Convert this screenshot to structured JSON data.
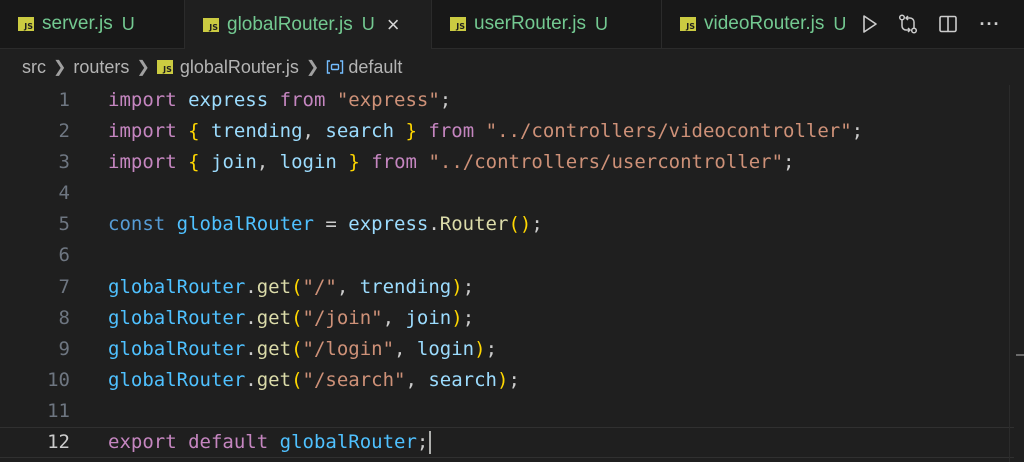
{
  "tabs": [
    {
      "name": "server.js",
      "status": "U",
      "active": false
    },
    {
      "name": "globalRouter.js",
      "status": "U",
      "active": true
    },
    {
      "name": "userRouter.js",
      "status": "U",
      "active": false
    },
    {
      "name": "videoRouter.js",
      "status": "U",
      "active": false
    }
  ],
  "tab_file_icon": "JS",
  "tab_close_glyph": "×",
  "editor_actions": [
    "run-icon",
    "compare-changes-icon",
    "split-editor-icon",
    "more-actions-icon"
  ],
  "more_glyph": "···",
  "breadcrumb": {
    "folder1": "src",
    "folder2": "routers",
    "file": "globalRouter.js",
    "symbol": "default"
  },
  "line_numbers": [
    "1",
    "2",
    "3",
    "4",
    "5",
    "6",
    "7",
    "8",
    "9",
    "10",
    "11",
    "12"
  ],
  "active_line": "12",
  "code": {
    "l1": {
      "t1": "import",
      "t2": " ",
      "t3": "express",
      "t4": " ",
      "t5": "from",
      "t6": " ",
      "t7": "\"express\"",
      "t8": ";"
    },
    "l2": {
      "t1": "import",
      "t2": " ",
      "t3": "{",
      "t4": " ",
      "t5": "trending",
      "t6": ", ",
      "t7": "search",
      "t8": " ",
      "t9": "}",
      "t10": " ",
      "t11": "from",
      "t12": " ",
      "t13": "\"../controllers/videocontroller\"",
      "t14": ";"
    },
    "l3": {
      "t1": "import",
      "t2": " ",
      "t3": "{",
      "t4": " ",
      "t5": "join",
      "t6": ", ",
      "t7": "login",
      "t8": " ",
      "t9": "}",
      "t10": " ",
      "t11": "from",
      "t12": " ",
      "t13": "\"../controllers/usercontroller\"",
      "t14": ";"
    },
    "l5": {
      "t1": "const",
      "t2": " ",
      "t3": "globalRouter",
      "t4": " = ",
      "t5": "express",
      "t6": ".",
      "t7": "Router",
      "t8": "(",
      "t9": ")",
      "t10": ";"
    },
    "l7": {
      "t1": "globalRouter",
      "t2": ".",
      "t3": "get",
      "t4": "(",
      "t5": "\"/\"",
      "t6": ", ",
      "t7": "trending",
      "t8": ")",
      "t9": ";"
    },
    "l8": {
      "t1": "globalRouter",
      "t2": ".",
      "t3": "get",
      "t4": "(",
      "t5": "\"/join\"",
      "t6": ", ",
      "t7": "join",
      "t8": ")",
      "t9": ";"
    },
    "l9": {
      "t1": "globalRouter",
      "t2": ".",
      "t3": "get",
      "t4": "(",
      "t5": "\"/login\"",
      "t6": ", ",
      "t7": "login",
      "t8": ")",
      "t9": ";"
    },
    "l10": {
      "t1": "globalRouter",
      "t2": ".",
      "t3": "get",
      "t4": "(",
      "t5": "\"/search\"",
      "t6": ", ",
      "t7": "search",
      "t8": ")",
      "t9": ";"
    },
    "l12": {
      "t1": "export",
      "t2": " ",
      "t3": "default",
      "t4": " ",
      "t5": "globalRouter",
      "t6": ";"
    }
  },
  "colors": {
    "background": "#1f1f1f",
    "keyword_control": "#c586c0",
    "keyword_storage": "#569cd6",
    "variable": "#9cdcfe",
    "constant": "#4fc1ff",
    "function": "#dcdcaa",
    "string": "#ce9178",
    "bracket": "#ffd700",
    "untracked": "#73c991",
    "js_icon": "#cbcb41"
  }
}
